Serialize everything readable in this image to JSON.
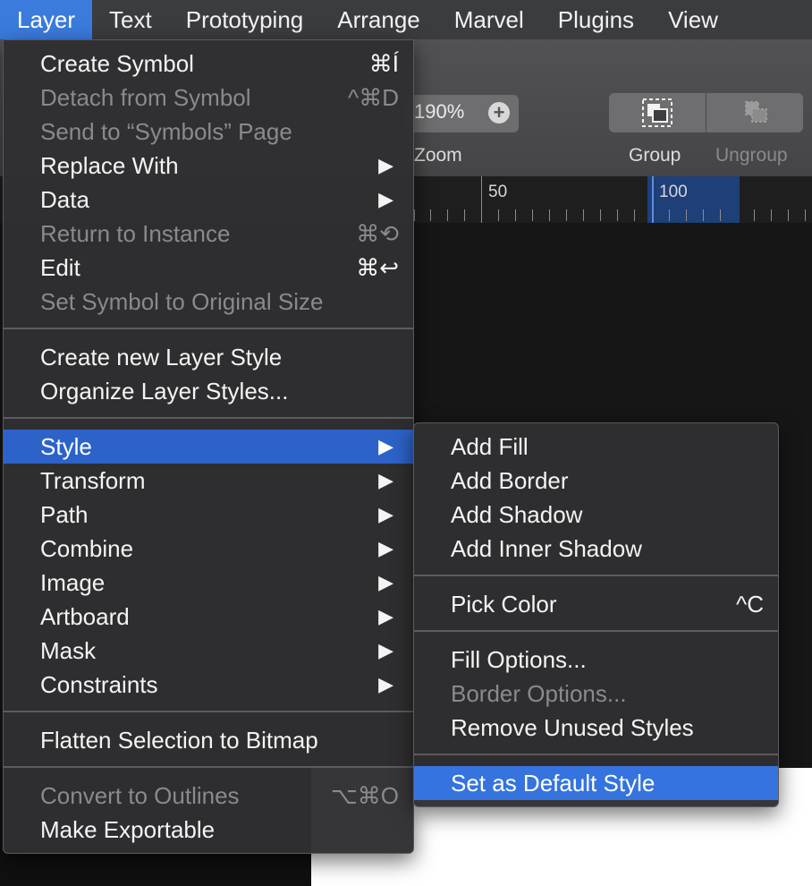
{
  "menubar": {
    "items": [
      "Layer",
      "Text",
      "Prototyping",
      "Arrange",
      "Marvel",
      "Plugins",
      "View"
    ],
    "active_index": 0
  },
  "toolbar": {
    "zoom_value": "190%",
    "zoom_plus": "+",
    "zoom_label": "Zoom",
    "group_label": "Group",
    "ungroup_label": "Ungroup"
  },
  "ruler": {
    "labels": [
      "50",
      "100"
    ]
  },
  "layer_menu": {
    "create_symbol": {
      "label": "Create Symbol",
      "shortcut": "⌘Í"
    },
    "detach_symbol": {
      "label": "Detach from Symbol",
      "shortcut": "^⌘D"
    },
    "send_symbols_page": {
      "label": "Send to “Symbols” Page"
    },
    "replace_with": {
      "label": "Replace With",
      "arrow": "▶"
    },
    "data": {
      "label": "Data",
      "arrow": "▶"
    },
    "return_instance": {
      "label": "Return to Instance",
      "shortcut": "⌘⟲"
    },
    "edit": {
      "label": "Edit",
      "shortcut": "⌘↩"
    },
    "set_original_size": {
      "label": "Set Symbol to Original Size"
    },
    "create_layer_style": {
      "label": "Create new Layer Style"
    },
    "organize_layer_styles": {
      "label": "Organize Layer Styles..."
    },
    "style": {
      "label": "Style",
      "arrow": "▶"
    },
    "transform": {
      "label": "Transform",
      "arrow": "▶"
    },
    "path": {
      "label": "Path",
      "arrow": "▶"
    },
    "combine": {
      "label": "Combine",
      "arrow": "▶"
    },
    "image": {
      "label": "Image",
      "arrow": "▶"
    },
    "artboard": {
      "label": "Artboard",
      "arrow": "▶"
    },
    "mask": {
      "label": "Mask",
      "arrow": "▶"
    },
    "constraints": {
      "label": "Constraints",
      "arrow": "▶"
    },
    "flatten_bitmap": {
      "label": "Flatten Selection to Bitmap"
    },
    "convert_outlines": {
      "label": "Convert to Outlines",
      "shortcut": "⌥⌘O"
    },
    "make_exportable": {
      "label": "Make Exportable"
    }
  },
  "style_submenu": {
    "add_fill": {
      "label": "Add Fill"
    },
    "add_border": {
      "label": "Add Border"
    },
    "add_shadow": {
      "label": "Add Shadow"
    },
    "add_inner_shadow": {
      "label": "Add Inner Shadow"
    },
    "pick_color": {
      "label": "Pick Color",
      "shortcut": "^C"
    },
    "fill_options": {
      "label": "Fill Options..."
    },
    "border_options": {
      "label": "Border Options..."
    },
    "remove_unused": {
      "label": "Remove Unused Styles"
    },
    "set_default": {
      "label": "Set as Default Style"
    }
  }
}
